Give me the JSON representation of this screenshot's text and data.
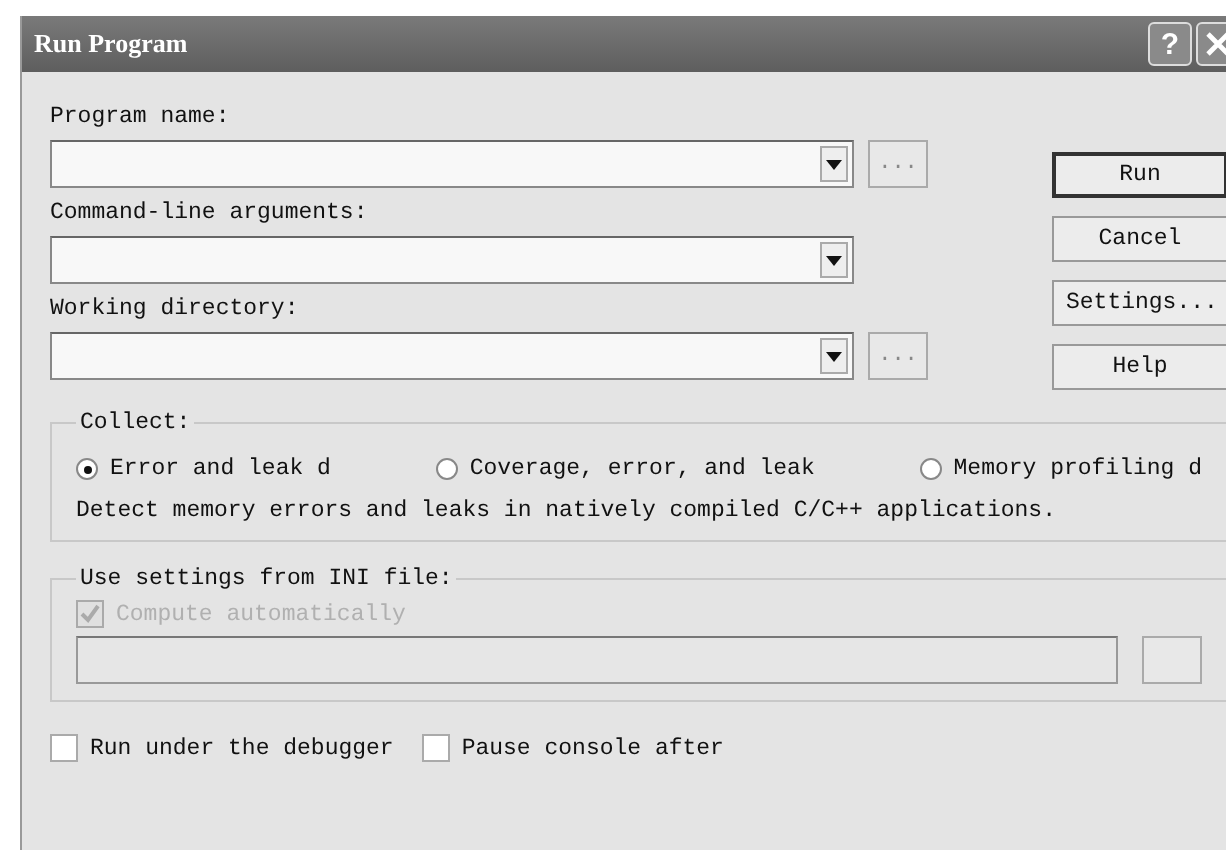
{
  "window": {
    "title": "Run Program"
  },
  "title_buttons": [
    {
      "kind": "help",
      "label": "?"
    },
    {
      "kind": "close"
    }
  ],
  "fields": [
    {
      "label": "Program name:",
      "browse_label": "..."
    },
    {
      "label": "Command-line arguments:"
    },
    {
      "label": "Working directory:",
      "browse_label": "..."
    }
  ],
  "buttons": [
    {
      "label": "Run",
      "default": true
    },
    {
      "label": "Cancel",
      "default": false
    },
    {
      "label": "Settings...",
      "default": false
    },
    {
      "label": "Help",
      "default": false
    }
  ],
  "collect": {
    "title": "Collect:",
    "options": [
      {
        "label": "Error and leak d",
        "selected": true
      },
      {
        "label": "Coverage, error, and leak",
        "selected": false
      },
      {
        "label": "Memory profiling d",
        "selected": false
      }
    ],
    "description": "Detect memory errors and leaks in natively compiled C/C++ applications."
  },
  "ini": {
    "title": "Use settings from INI file:",
    "compute": {
      "label": "Compute automatically",
      "checked": true,
      "disabled": true
    }
  },
  "checkboxes": [
    {
      "label": "Run under the debugger",
      "checked": false
    },
    {
      "label": "Pause console after",
      "checked": false
    }
  ]
}
